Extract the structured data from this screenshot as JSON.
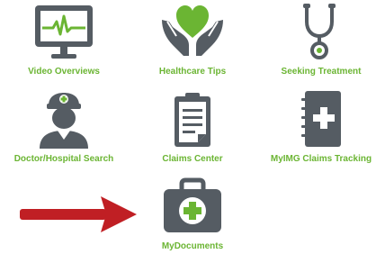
{
  "menu": {
    "items": [
      {
        "label": "Video Overviews",
        "icon": "monitor-heartbeat-icon"
      },
      {
        "label": "Healthcare Tips",
        "icon": "hands-heart-icon"
      },
      {
        "label": "Seeking Treatment",
        "icon": "stethoscope-icon"
      },
      {
        "label": "Doctor/Hospital Search",
        "icon": "nurse-icon"
      },
      {
        "label": "Claims Center",
        "icon": "clipboard-icon"
      },
      {
        "label": "MyIMG Claims Tracking",
        "icon": "medical-notebook-icon"
      },
      {
        "label": "MyDocuments",
        "icon": "medical-kit-icon"
      }
    ]
  },
  "colors": {
    "icon_dark": "#555c63",
    "accent_green": "#6bb533",
    "arrow_red": "#c01f24"
  }
}
